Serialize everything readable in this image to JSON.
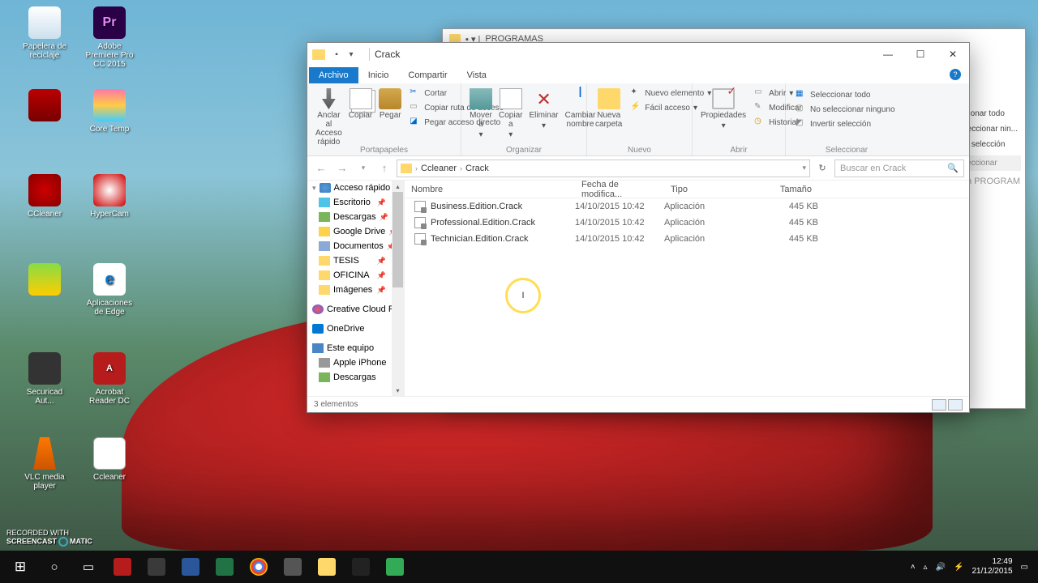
{
  "desktop_icons": {
    "recycle": "Papelera de reciclaje",
    "premiere": "Adobe Premiere Pro CC 2015",
    "premiere_badge": "Pr",
    "red": "",
    "coretemp": "Core Temp",
    "ccleaner": "CCleaner",
    "hypercam": "HyperCam",
    "bird": "",
    "edge": "Aplicaciones de Edge",
    "edge_badge": "e",
    "acro": "Securicad Aut...",
    "pdf": "Acrobat Reader DC",
    "pdf_badge": "A",
    "vlc": "VLC media player",
    "cc2": "Ccleaner"
  },
  "bg_window": {
    "title": "PROGRAMAS",
    "select_all": "Seleccionar todo",
    "select_none": "No seleccionar nin...",
    "select_inv": "Invertir selección",
    "group": "Seleccionar",
    "search": "Buscar en PROGRAM"
  },
  "window": {
    "title": "Crack",
    "tabs": {
      "archivo": "Archivo",
      "inicio": "Inicio",
      "compartir": "Compartir",
      "vista": "Vista"
    },
    "ribbon": {
      "clipboard": {
        "pin": "Anclar al Acceso rápido",
        "copy": "Copiar",
        "paste": "Pegar",
        "cut": "Cortar",
        "copypath": "Copiar ruta de acceso",
        "shortcut": "Pegar acceso directo",
        "label": "Portapapeles"
      },
      "organize": {
        "move": "Mover a",
        "copy": "Copiar a",
        "delete": "Eliminar",
        "rename": "Cambiar nombre",
        "label": "Organizar"
      },
      "new": {
        "folder": "Nueva carpeta",
        "item": "Nuevo elemento",
        "easy": "Fácil acceso",
        "label": "Nuevo"
      },
      "open": {
        "props": "Propiedades",
        "open": "Abrir",
        "edit": "Modificar",
        "history": "Historial",
        "label": "Abrir"
      },
      "select": {
        "all": "Seleccionar todo",
        "none": "No seleccionar ninguno",
        "inv": "Invertir selección",
        "label": "Seleccionar"
      }
    },
    "breadcrumb": {
      "p1": "Ccleaner",
      "p2": "Crack"
    },
    "search_placeholder": "Buscar en Crack",
    "nav": {
      "quick": "Acceso rápido",
      "desktop": "Escritorio",
      "downloads": "Descargas",
      "gdrive": "Google Drive",
      "docs": "Documentos",
      "tesis": "TESIS",
      "oficina": "OFICINA",
      "images": "Imágenes",
      "ccf": "Creative Cloud Fil...",
      "onedrive": "OneDrive",
      "thispc": "Este equipo",
      "iphone": "Apple iPhone",
      "downloads2": "Descargas"
    },
    "columns": {
      "name": "Nombre",
      "date": "Fecha de modifica...",
      "type": "Tipo",
      "size": "Tamaño"
    },
    "files": [
      {
        "name": "Business.Edition.Crack",
        "date": "14/10/2015 10:42",
        "type": "Aplicación",
        "size": "445 KB"
      },
      {
        "name": "Professional.Edition.Crack",
        "date": "14/10/2015 10:42",
        "type": "Aplicación",
        "size": "445 KB"
      },
      {
        "name": "Technician.Edition.Crack",
        "date": "14/10/2015 10:42",
        "type": "Aplicación",
        "size": "445 KB"
      }
    ],
    "status": "3 elementos"
  },
  "taskbar": {
    "tray": {
      "time": "12:49",
      "date": "21/12/2015"
    }
  },
  "watermark": {
    "l1": "RECORDED WITH",
    "l2a": "SCREENCAST",
    "l2b": "MATIC"
  }
}
